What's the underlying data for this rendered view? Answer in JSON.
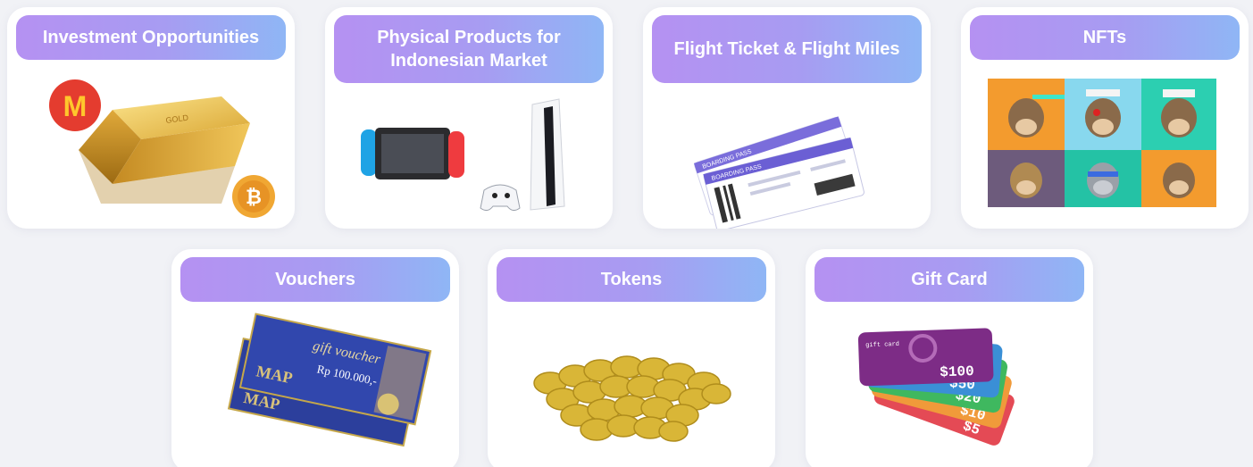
{
  "categories": [
    {
      "id": "investment",
      "label": "Investment Opportunities",
      "icon": "gold-bar-icon"
    },
    {
      "id": "physical",
      "label": "Physical Products for Indonesian Market",
      "icon": "game-console-icon"
    },
    {
      "id": "flight",
      "label": "Flight Ticket & Flight Miles",
      "icon": "flight-ticket-icon"
    },
    {
      "id": "nfts",
      "label": "NFTs",
      "icon": "nft-collage-icon"
    },
    {
      "id": "vouchers",
      "label": "Vouchers",
      "icon": "gift-voucher-icon"
    },
    {
      "id": "tokens",
      "label": "Tokens",
      "icon": "gold-coins-icon"
    },
    {
      "id": "giftcard",
      "label": "Gift Card",
      "icon": "gift-cards-icon"
    }
  ],
  "art_text": {
    "gold_bar": "GOLD",
    "bitcoin": "₿",
    "mcd": "M",
    "ticket_header": "BOARDING PASS",
    "voucher_title": "gift voucher",
    "voucher_amount": "Rp 100.000,-",
    "voucher_brand": "MAP",
    "giftcard_small": "gift card",
    "giftcard_values": [
      "$100",
      "$50",
      "$20",
      "$10",
      "$5"
    ]
  },
  "colors": {
    "pill_start": "#b591f2",
    "pill_end": "#8fb6f5",
    "card_bg": "#ffffff",
    "page_bg": "#f1f2f6"
  }
}
